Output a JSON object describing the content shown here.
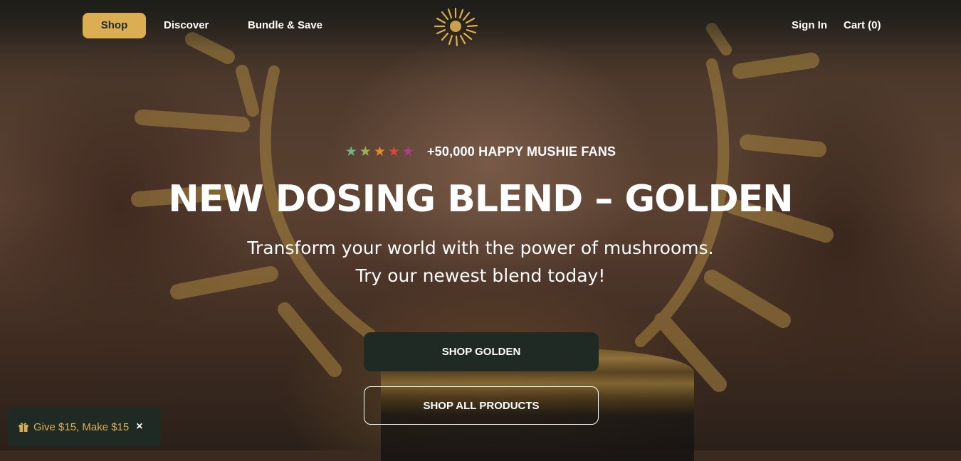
{
  "nav": {
    "shop": "Shop",
    "discover": "Discover",
    "bundle": "Bundle & Save",
    "sign_in": "Sign In",
    "cart": "Cart (0)"
  },
  "hero": {
    "stars": "★",
    "star_colors": [
      "#6fb38a",
      "#9ab452",
      "#e38a2c",
      "#d8473e",
      "#b23a8e"
    ],
    "fans": "+50,000 HAPPY MUSHIE FANS",
    "headline": "NEW DOSING BLEND – GOLDEN",
    "subtitle_line1": "Transform your world with the power of mushrooms.",
    "subtitle_line2": "Try our newest blend today!",
    "cta_primary": "SHOP GOLDEN",
    "cta_secondary": "SHOP ALL PRODUCTS"
  },
  "promo": {
    "label": "Give $15, Make $15",
    "close": "×"
  },
  "colors": {
    "accent": "#dcae52",
    "dark": "#1f2a24"
  }
}
